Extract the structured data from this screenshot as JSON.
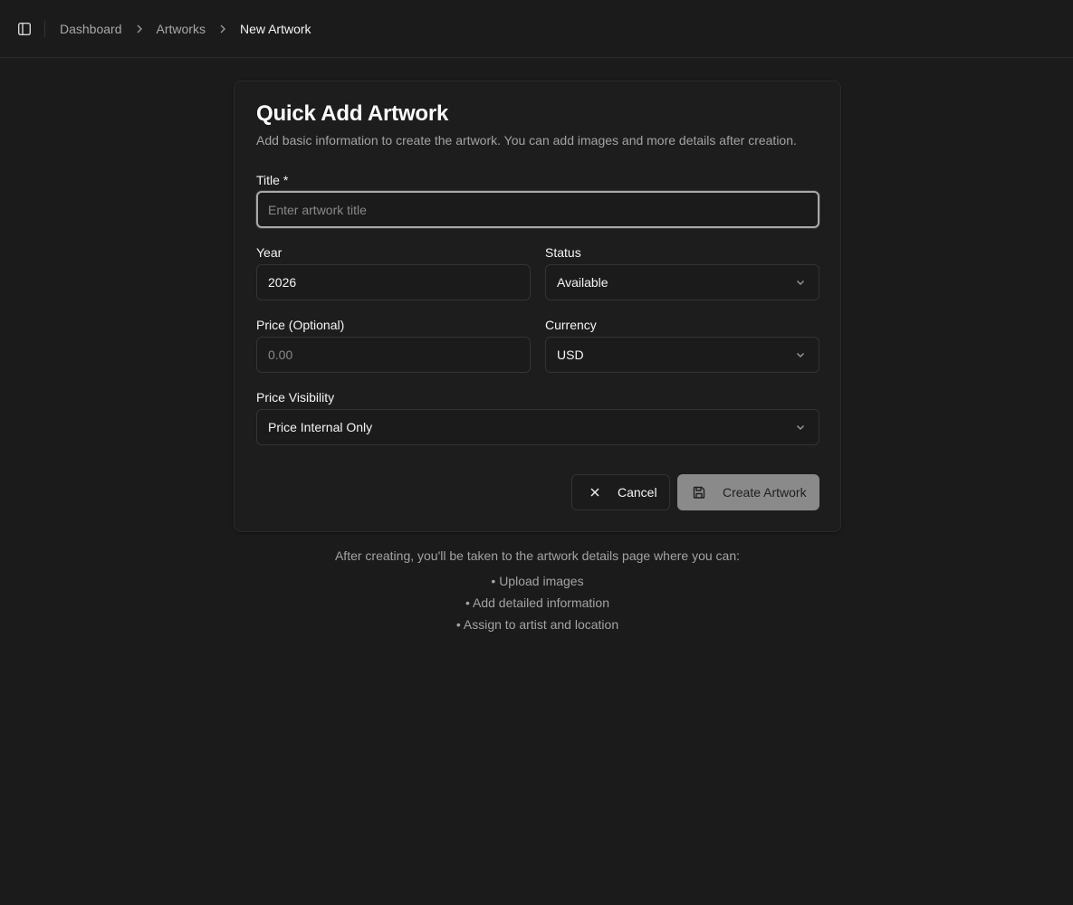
{
  "breadcrumb": {
    "items": [
      "Dashboard",
      "Artworks"
    ],
    "current": "New Artwork"
  },
  "form": {
    "title": "Quick Add Artwork",
    "description": "Add basic information to create the artwork. You can add images and more details after creation.",
    "title_label": "Title *",
    "title_placeholder": "Enter artwork title",
    "year_label": "Year",
    "year_value": "2026",
    "status_label": "Status",
    "status_value": "Available",
    "price_label": "Price (Optional)",
    "price_placeholder": "0.00",
    "currency_label": "Currency",
    "currency_value": "USD",
    "visibility_label": "Price Visibility",
    "visibility_value": "Price Internal Only",
    "cancel_label": "Cancel",
    "create_label": "Create Artwork"
  },
  "after": {
    "intro": "After creating, you'll be taken to the artwork details page where you can:",
    "items": [
      "• Upload images",
      "• Add detailed information",
      "• Assign to artist and location"
    ]
  },
  "icons": {
    "sidebar_toggle": "panel-left-icon",
    "separator": "chevron-right-icon",
    "select": "chevron-down-icon",
    "cancel": "x-icon",
    "create": "save-icon"
  }
}
